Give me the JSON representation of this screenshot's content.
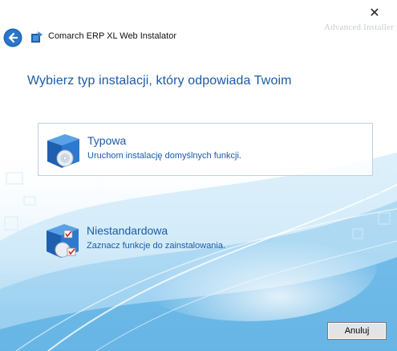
{
  "window": {
    "title": "Comarch ERP XL Web Instalator",
    "watermark": "Advanced Installer"
  },
  "heading": "Wybierz typ instalacji, który odpowiada Twoim",
  "options": [
    {
      "title": "Typowa",
      "description": "Uruchom instalację domyślnych funkcji.",
      "icon": "box-disc-icon",
      "selected": true
    },
    {
      "title": "Niestandardowa",
      "description": "Zaznacz funkcje do zainstalowania.",
      "icon": "box-custom-icon",
      "selected": false
    }
  ],
  "footer": {
    "cancel_label": "Anuluj"
  },
  "colors": {
    "accent": "#1a5ba8",
    "back_button": "#1c63b4",
    "background_swoosh": "#cfe8f7"
  }
}
